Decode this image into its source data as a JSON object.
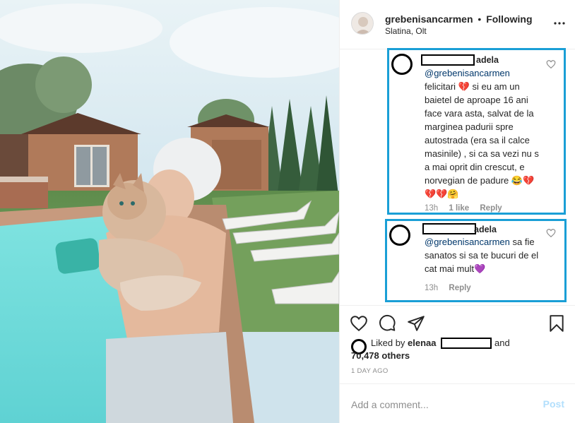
{
  "post": {
    "username": "grebenisancarmen",
    "separator": "•",
    "follow_status": "Following",
    "location": "Slatina, Olt",
    "more_icon": "more-dots-icon"
  },
  "comments": [
    {
      "username_suffix": "adela",
      "mention": "@grebenisancarmen",
      "text": "felicitari 💔 si eu am un baietel de aproape 16 ani face vara asta, salvat de la marginea padurii spre autostrada (era sa il calce masinile) , si ca sa vezi nu s a mai oprit din crescut, e norvegian de padure",
      "emojis": "😂💔💔💔🤗",
      "time": "13h",
      "likes": "1 like",
      "reply": "Reply"
    },
    {
      "username_suffix": "adela",
      "mention": "@grebenisancarmen",
      "text": "sa fie sanatos si sa te bucuri de el cat mai mult",
      "emojis": "💜",
      "time": "13h",
      "reply": "Reply"
    }
  ],
  "likes": {
    "prefix": "Liked by",
    "user": "elenaa",
    "and": "and",
    "others": "70,478 others"
  },
  "timestamp": "1 DAY AGO",
  "add_comment": {
    "placeholder": "Add a comment...",
    "post_label": "Post"
  },
  "colors": {
    "highlight_border": "#1a9fd6",
    "mention": "#00376b",
    "muted": "#8e8e8e",
    "post_disabled": "#b2dffc"
  }
}
